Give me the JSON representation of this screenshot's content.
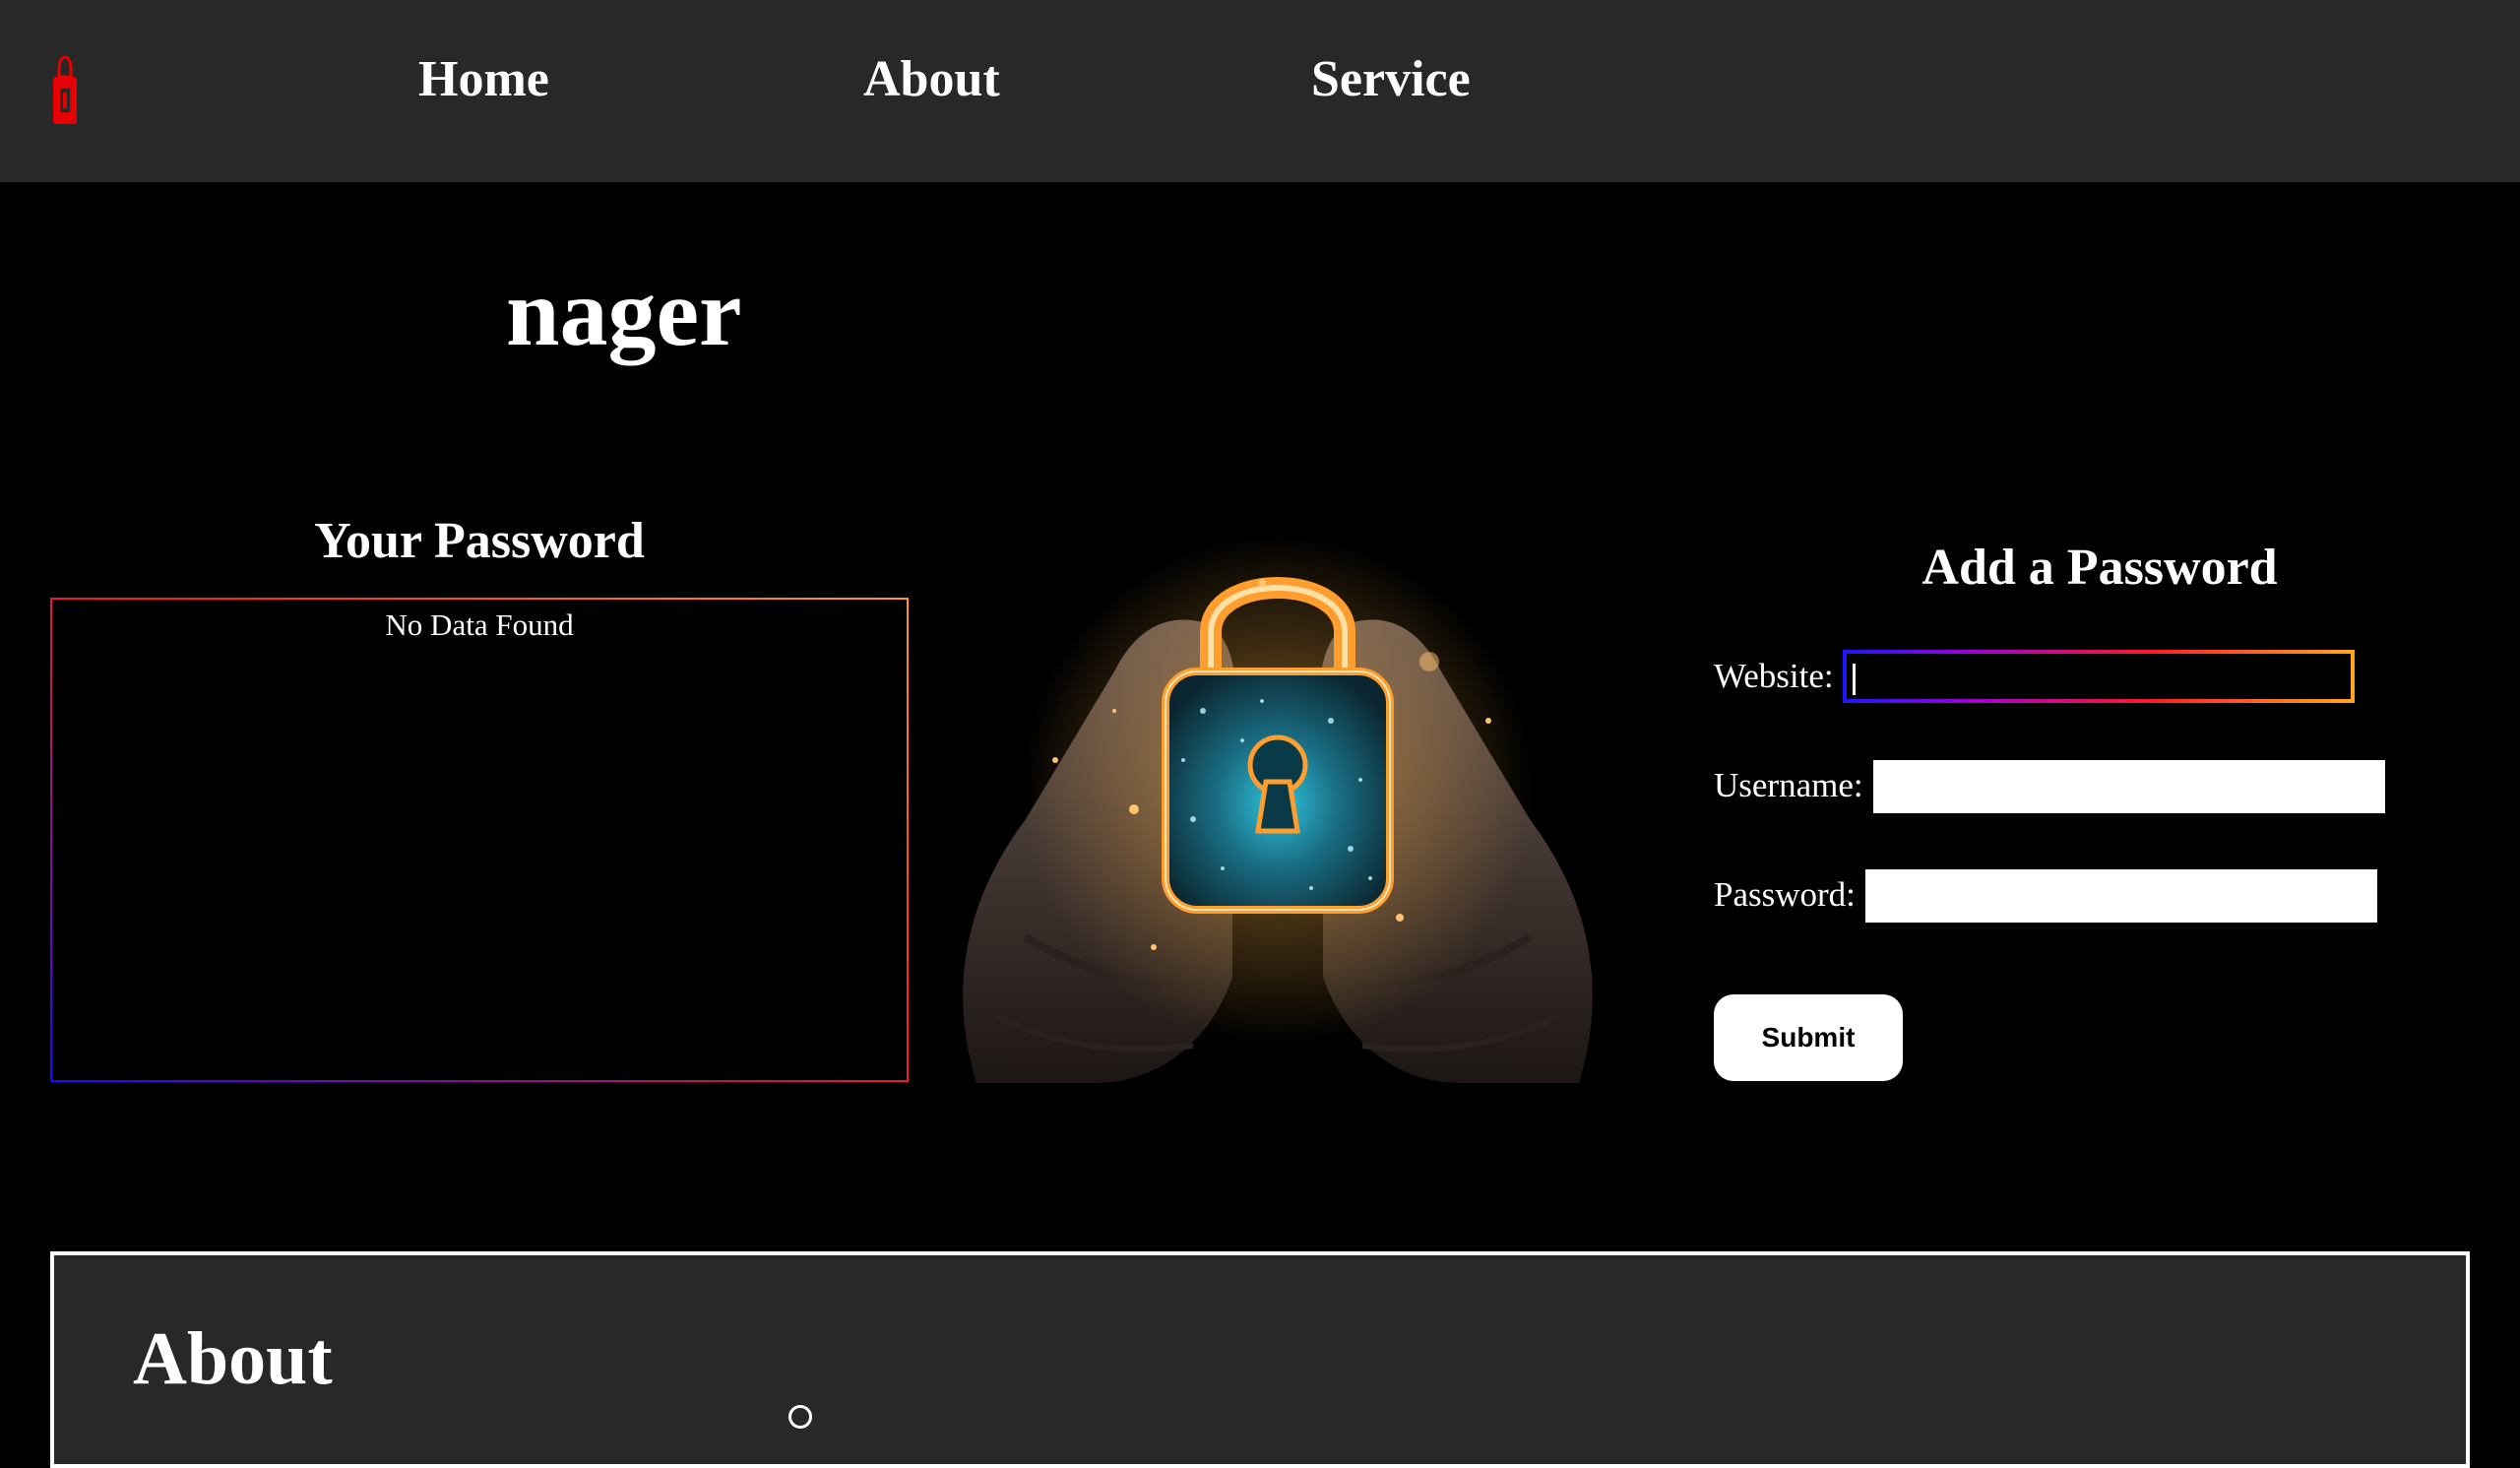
{
  "colors": {
    "nav_bg": "#282828",
    "page_bg": "#000000",
    "accent_red": "#ff1a1a",
    "accent_orange": "#ffa81a",
    "accent_blue": "#2a00ff"
  },
  "nav": {
    "logo_icon": "lipstick-lock-icon",
    "links": [
      {
        "label": "Home"
      },
      {
        "label": "About"
      },
      {
        "label": "Service"
      }
    ]
  },
  "page": {
    "title": "nager"
  },
  "passwords": {
    "heading": "Your Password",
    "empty_text": "No Data Found"
  },
  "hero_image": {
    "icon": "padlock-in-hands-image"
  },
  "form": {
    "heading": "Add a Password",
    "website_label": "Website:",
    "website_value": "",
    "username_label": "Username:",
    "username_value": "",
    "password_label": "Password:",
    "password_value": "",
    "submit_label": "Submit"
  },
  "about": {
    "heading": "About"
  }
}
